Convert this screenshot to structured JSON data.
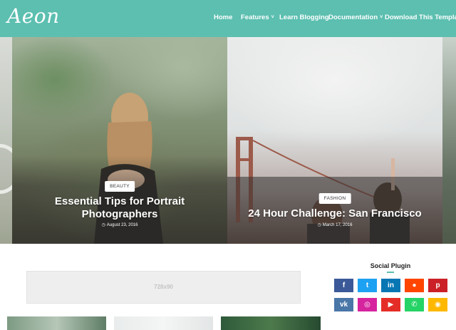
{
  "header": {
    "logo": "Aeon",
    "nav": [
      {
        "label": "Home",
        "dropdown": false
      },
      {
        "label": "Features",
        "dropdown": true
      },
      {
        "label": "Learn Blogging",
        "dropdown": false
      },
      {
        "label": "Documentation",
        "dropdown": true
      },
      {
        "label": "Download This Template",
        "dropdown": false
      }
    ],
    "dropdown_glyph": "˅"
  },
  "slides": [
    {
      "tag": "BEAUTY",
      "title_line1": "Essential Tips for Portrait",
      "title_line2": "Photographers",
      "date": "August 23, 2016"
    },
    {
      "tag": "FASHION",
      "title": "24 Hour Challenge: San Francisco",
      "date": "March 17, 2016"
    }
  ],
  "ad": {
    "label": "728x90"
  },
  "social": {
    "title": "Social Plugin",
    "buttons": [
      {
        "name": "facebook",
        "glyph": "f",
        "color": "#3b5998"
      },
      {
        "name": "twitter",
        "glyph": "t",
        "color": "#1da1f2"
      },
      {
        "name": "linkedin",
        "glyph": "in",
        "color": "#0976b4"
      },
      {
        "name": "reddit",
        "glyph": "●",
        "color": "#ff4500"
      },
      {
        "name": "pinterest",
        "glyph": "p",
        "color": "#cb2027"
      },
      {
        "name": "vk",
        "glyph": "vk",
        "color": "#4a76a8"
      },
      {
        "name": "instagram",
        "glyph": "◎",
        "color": "#d6249f"
      },
      {
        "name": "youtube",
        "glyph": "▶",
        "color": "#e52d27"
      },
      {
        "name": "whatsapp",
        "glyph": "✆",
        "color": "#25d366"
      },
      {
        "name": "rss",
        "glyph": "◉",
        "color": "#ffb800"
      }
    ]
  },
  "colors": {
    "accent": "#5cbfb0"
  }
}
